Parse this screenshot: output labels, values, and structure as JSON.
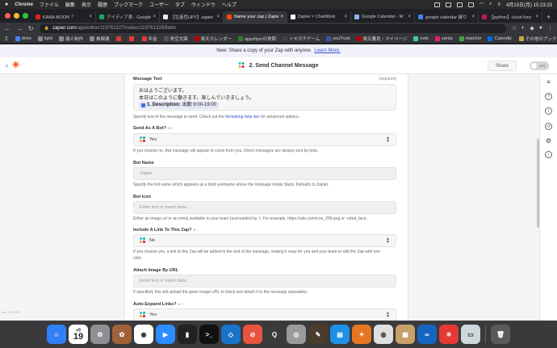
{
  "menubar": {
    "items": [
      "Chrome",
      "ファイル",
      "編集",
      "表示",
      "履歴",
      "ブックマーク",
      "ユーザー",
      "タブ",
      "ウィンドウ",
      "ヘルプ"
    ],
    "clock": "4月19日(月) 15:23:23"
  },
  "tabs": [
    {
      "title": "KANA-BOON「",
      "color": "#e02020",
      "active": false
    },
    {
      "title": "アイディア表 - Google",
      "color": "#1fa463",
      "active": false
    },
    {
      "title": "【生産性UP!!】zapier",
      "color": "#e8e8e8",
      "active": false
    },
    {
      "title": "Name your zap | Zapier",
      "color": "#ff4a00",
      "active": true
    },
    {
      "title": "Zapier × ChatWork",
      "color": "#ffffff",
      "active": false
    },
    {
      "title": "Google Calendar - W",
      "color": "#8ab4f8",
      "active": false
    },
    {
      "title": "google calendar 繰り",
      "color": "#4285f4",
      "active": false
    },
    {
      "title": "【python】cloud func",
      "color": "#c2185b",
      "active": false
    }
  ],
  "address": {
    "host": "zapier.com",
    "path": "/app/editor/119761327/nodes/119761328/fields"
  },
  "bookmarks": [
    {
      "label": "drive",
      "color": "#4285f4"
    },
    {
      "label": "light",
      "color": "#8a8a8a"
    },
    {
      "label": "個人制作",
      "color": "#8a8a8a"
    },
    {
      "label": "株関連",
      "color": "#8a8a8a"
    },
    {
      "label": "",
      "color": "#e53935"
    },
    {
      "label": "",
      "color": "#e53935"
    },
    {
      "label": "年金",
      "color": "#e53935"
    },
    {
      "label": "青空文庫",
      "color": "#555"
    },
    {
      "label": "楽天カレンダー",
      "color": "#bf0000"
    },
    {
      "label": "appsflyerの質問",
      "color": "#2e7d32"
    },
    {
      "label": "トモガチゲーム",
      "color": "#444"
    },
    {
      "label": "youTrust",
      "color": "#3f51b5"
    },
    {
      "label": "楽天鷹見・マイページ",
      "color": "#bf0000"
    },
    {
      "label": "note",
      "color": "#41c9b4"
    },
    {
      "label": "yenta",
      "color": "#e91e63"
    },
    {
      "label": "matcher",
      "color": "#43a047"
    },
    {
      "label": "Calendly",
      "color": "#006bff"
    }
  ],
  "bookmarks_other": "その他のブックマーク",
  "banner": {
    "text": "New: Share a copy of your Zap with anyone.",
    "link": "Learn More."
  },
  "header": {
    "step_title": "2. Send Channel Message",
    "share_label": "Share",
    "toggle_label": "OFF"
  },
  "form": {
    "message_text": {
      "label": "Message Text",
      "required": "(required)",
      "line1": "おはようございます。",
      "line2": "本日はこのように働きます。楽しんでいきましょう。",
      "pill_label": "1. Description:",
      "pill_value": "出勤 9:00-19:00",
      "help_pre": "Specify text of the message to send. Check out the",
      "help_link": "formatting help doc",
      "help_post": "for advanced options."
    },
    "send_as_bot": {
      "label": "Send As A Bot?",
      "value": "Yes",
      "help": "If you choose no, this message will appear to come from you. Direct messages are always sent by bots."
    },
    "bot_name": {
      "label": "Bot Name",
      "placeholder": "Zapier",
      "help": "Specify the bot name which appears as a bold username above the message inside Slack. Defaults to Zapier."
    },
    "bot_icon": {
      "label": "Bot Icon",
      "placeholder": "Enter text or insert data...",
      "help": "Either an image url or an emoji available to your team (surrounded by :). For example, https://site.com/icon_256.png or :robot_face:"
    },
    "include_link": {
      "label": "Include A Link To This Zap?",
      "value": "No",
      "help1": "If you choose yes, a link to this Zap will be added to the end of the message, making it easy for you and your team to edit the Zap with one",
      "help2": "click."
    },
    "attach_image": {
      "label": "Attach Image By URL",
      "placeholder": "Enter text or insert data...",
      "help": "If specified, this will upload the given image URL to Slack and attach it to the message separately."
    },
    "auto_expand": {
      "label": "Auto-Expand Links?",
      "value": "Yes"
    }
  },
  "version": "ver. 9c71140",
  "dock": [
    {
      "name": "finder",
      "color": "#2f7ff5",
      "glyph": "☺"
    },
    {
      "name": "calendar",
      "month": "4月",
      "day": "19"
    },
    {
      "name": "system-preferences",
      "color": "#8e8e93",
      "glyph": "⚙"
    },
    {
      "name": "photos-app",
      "color": "#a0623a",
      "glyph": "✿"
    },
    {
      "name": "chrome",
      "color": "#ffffff",
      "glyph": "◉"
    },
    {
      "name": "zoom",
      "color": "#2d8cff",
      "glyph": "▶"
    },
    {
      "name": "terminal-green",
      "color": "#222",
      "glyph": "▮"
    },
    {
      "name": "terminal",
      "color": "#111",
      "glyph": ">_"
    },
    {
      "name": "vscode",
      "color": "#1a73c8",
      "glyph": "◇"
    },
    {
      "name": "safari-like",
      "color": "#e8533f",
      "glyph": "⊘"
    },
    {
      "name": "quicktime",
      "color": "#3b3b3b",
      "glyph": "Q"
    },
    {
      "name": "disk-utility",
      "color": "#9a9a9a",
      "glyph": "◎"
    },
    {
      "name": "notes-app",
      "color": "#4a3b2c",
      "glyph": "✎"
    },
    {
      "name": "docker",
      "color": "#1d91e6",
      "glyph": "▤"
    },
    {
      "name": "sourcetree",
      "color": "#e87722",
      "glyph": "✦"
    },
    {
      "name": "contacts",
      "color": "#e0e0e0",
      "glyph": "◍"
    },
    {
      "name": "preview",
      "color": "#c8a06a",
      "glyph": "▦"
    },
    {
      "name": "infinity-app",
      "color": "#1565c0",
      "glyph": "∞"
    },
    {
      "name": "clock-app",
      "color": "#e53935",
      "glyph": "✳"
    },
    {
      "name": "screenshot-app",
      "color": "#cfd8dc",
      "glyph": "▭"
    },
    {
      "name": "trash",
      "color": "#5a5a5a",
      "glyph": "🗑"
    }
  ]
}
